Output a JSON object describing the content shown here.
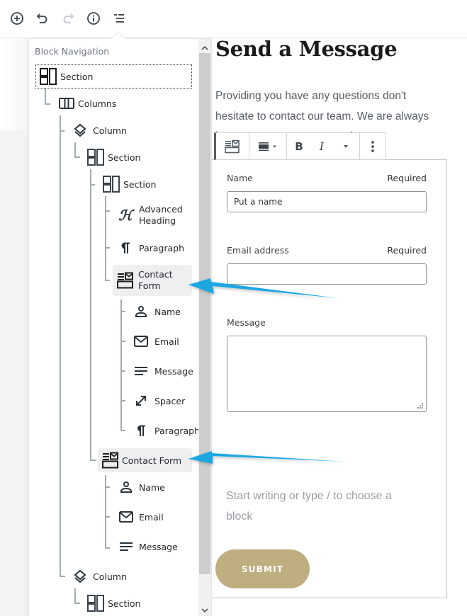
{
  "toolbar": {
    "buttons": [
      {
        "name": "add-block",
        "icon": "plus-circle-icon"
      },
      {
        "name": "undo",
        "icon": "undo-icon"
      },
      {
        "name": "redo",
        "icon": "redo-icon",
        "disabled": true
      },
      {
        "name": "content-info",
        "icon": "info-icon"
      },
      {
        "name": "block-navigation",
        "icon": "list-icon"
      }
    ]
  },
  "block_navigation": {
    "title": "Block Navigation",
    "items": [
      {
        "label": "Section",
        "icon": "section-icon",
        "level": 0
      },
      {
        "label": "Columns",
        "icon": "columns-icon",
        "level": 1
      },
      {
        "label": "Column",
        "icon": "layers-icon",
        "level": 2
      },
      {
        "label": "Section",
        "icon": "section-icon",
        "level": 3
      },
      {
        "label": "Section",
        "icon": "section-icon",
        "level": 4
      },
      {
        "label": "Advanced Heading",
        "icon": "heading-icon",
        "level": 5
      },
      {
        "label": "Paragraph",
        "icon": "paragraph-icon",
        "level": 5
      },
      {
        "label": "Contact Form",
        "icon": "contact-form-icon",
        "level": 5,
        "highlighted": true
      },
      {
        "label": "Name",
        "icon": "person-icon",
        "level": 6
      },
      {
        "label": "Email",
        "icon": "envelope-icon",
        "level": 6
      },
      {
        "label": "Message",
        "icon": "text-lines-icon",
        "level": 6
      },
      {
        "label": "Spacer",
        "icon": "resize-arrow-icon",
        "level": 6
      },
      {
        "label": "Paragraph",
        "icon": "paragraph-icon",
        "level": 6
      },
      {
        "label": "Contact Form",
        "icon": "contact-form-icon",
        "level": 4,
        "highlighted": true
      },
      {
        "label": "Name",
        "icon": "person-icon",
        "level": 5
      },
      {
        "label": "Email",
        "icon": "envelope-icon",
        "level": 5
      },
      {
        "label": "Message",
        "icon": "text-lines-icon",
        "level": 5
      },
      {
        "label": "Column",
        "icon": "layers-icon",
        "level": 2
      },
      {
        "label": "Section",
        "icon": "section-icon",
        "level": 3
      }
    ]
  },
  "editor": {
    "heading": "Send a Message",
    "paragraph": "Providing you have any questions don't hesitate to contact our team. We are always happy to answer your questions.",
    "block_toolbar": {
      "block_type_icon": "contact-form-icon",
      "align_icon": "align-center-icon",
      "bold": "B",
      "italic": "I",
      "more_icon": "more-vertical-icon"
    },
    "form": {
      "fields": [
        {
          "label": "Name",
          "required_label": "Required",
          "value": "Put a name",
          "type": "text"
        },
        {
          "label": "Email address",
          "required_label": "Required",
          "value": "",
          "type": "email"
        },
        {
          "label": "Message",
          "required_label": "",
          "value": "",
          "type": "textarea"
        }
      ],
      "placeholder": "Start writing or type / to choose a block",
      "submit_label": "SUBMIT"
    }
  },
  "colors": {
    "accent_arrow": "#1ea7e1",
    "submit_bg": "#bfae80",
    "text_muted": "#555d66"
  }
}
